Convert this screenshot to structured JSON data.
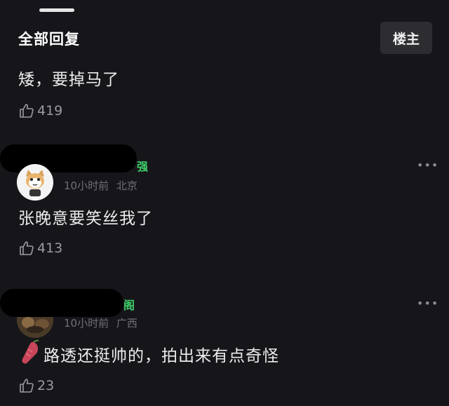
{
  "header": {
    "title": "全部回复",
    "op_button": "楼主"
  },
  "comments": [
    {
      "text": "矮，要掉马了",
      "likes": "419"
    },
    {
      "username_visible": "强",
      "time": "10小时前",
      "location": "北京",
      "text": "张晚意要笑丝我了",
      "likes": "413",
      "avatar": "cat-avatar"
    },
    {
      "username_visible": "阁",
      "time": "10小时前",
      "location": "广西",
      "text": "路透还挺帅的，拍出来有点奇怪",
      "likes": "23",
      "avatar": "photo-avatar",
      "emoji": "sweet-potato-icon"
    }
  ],
  "more_label": "•••",
  "colors": {
    "background": "#16161a",
    "username": "#3fd06a",
    "meta": "#6f6f77"
  }
}
